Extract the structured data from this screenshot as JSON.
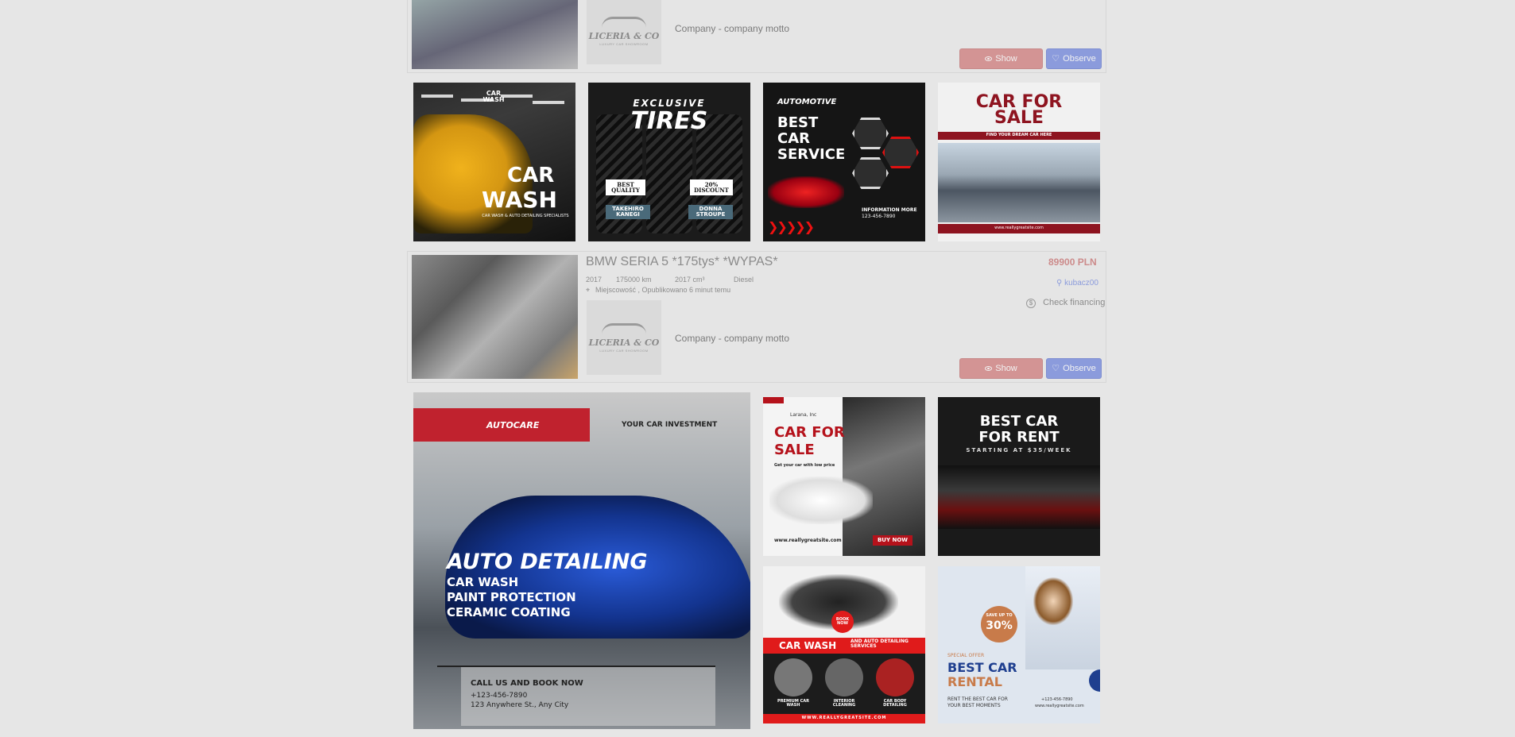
{
  "listing1": {
    "motto": "Company - company motto",
    "logo_name": "LICERIA & CO",
    "logo_sub": "LUXURY CAR SHOWROOM",
    "show_label": "Show",
    "observe_label": "Observe"
  },
  "listing2": {
    "title": "BMW SERIA 5 *175tys* *WYPAS*",
    "year": "2017",
    "mileage": "175000 km",
    "engine": "2017 cm³",
    "fuel": "Diesel",
    "location": "Miejscowość , Opublikowano 6 minut temu",
    "price": "89900 PLN",
    "seller": "kubacz00",
    "financing": "Check financing",
    "motto": "Company - company motto",
    "logo_name": "LICERIA & CO",
    "logo_sub": "LUXURY CAR SHOWROOM",
    "show_label": "Show",
    "observe_label": "Observe"
  },
  "ads_row1": {
    "wash": {
      "brand": "CAR WASH",
      "headline1": "CAR",
      "headline2": "WASH",
      "sub": "CAR WASH & AUTO DETAILING SPECIALISTS"
    },
    "tires": {
      "kicker": "EXCLUSIVE",
      "headline": "TIRES",
      "badge1": "BEST QUALITY",
      "badge2": "20% DISCOUNT",
      "name1": "TAKEHIRO KANEGI",
      "name2": "DONNA STROUPE"
    },
    "service": {
      "kicker": "AUTOMOTIVE",
      "line1": "BEST",
      "line2": "CAR",
      "line3": "SERVICE",
      "info": "INFORMATION MORE",
      "phone": "123-456-7890"
    },
    "sale": {
      "headline1": "CAR FOR",
      "headline2": "SALE",
      "strip": "FIND YOUR DREAM CAR HERE",
      "footer": "www.reallygreatsite.com"
    }
  },
  "ads_row2": {
    "detail": {
      "brand": "AUTOCARE",
      "tag": "YOUR CAR INVESTMENT",
      "headline": "AUTO DETAILING",
      "s1": "CAR WASH",
      "s2": "PAINT PROTECTION",
      "s3": "CERAMIC COATING",
      "cta": "CALL US AND BOOK NOW",
      "phone": "+123-456-7890",
      "address": "123 Anywhere St., Any City"
    },
    "sale2": {
      "brand": "Larana, Inc",
      "headline1": "CAR FOR",
      "headline2": "SALE",
      "sub": "Get your car with low price",
      "site": "www.reallygreatsite.com",
      "cta": "BUY NOW"
    },
    "rent": {
      "headline1": "BEST CAR",
      "headline2": "FOR RENT",
      "sub": "STARTING AT $35/WEEK"
    },
    "wash2": {
      "headline": "CAR WASH",
      "side": "AND AUTO DETAILING SERVICES",
      "book": "BOOK NOW",
      "c1": "PREMIUM CAR WASH",
      "c2": "INTERIOR CLEANING",
      "c3": "CAR BODY DETAILING",
      "site": "WWW.REALLYGREATSITE.COM"
    },
    "rental": {
      "save": "SAVE UP TO",
      "pct": "30%",
      "offer": "SPECIAL OFFER",
      "headline1": "BEST CAR",
      "headline2": "RENTAL",
      "sub": "RENT THE BEST CAR FOR YOUR BEST MOMENTS",
      "phone": "+123-456-7890",
      "site": "www.reallygreatsite.com"
    }
  }
}
